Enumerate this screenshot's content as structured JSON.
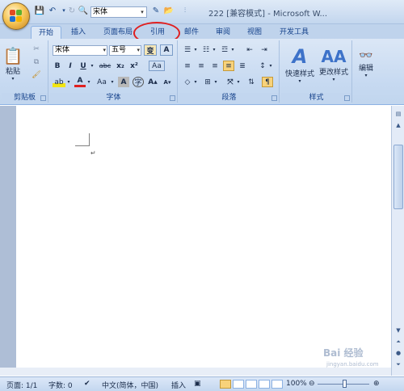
{
  "app": {
    "title": "222 [兼容模式] - Microsoft W..."
  },
  "quick_access": {
    "font_value": "宋体"
  },
  "tabs": [
    {
      "label": "开始",
      "active": true
    },
    {
      "label": "插入"
    },
    {
      "label": "页面布局"
    },
    {
      "label": "引用"
    },
    {
      "label": "邮件"
    },
    {
      "label": "审阅"
    },
    {
      "label": "视图"
    },
    {
      "label": "开发工具"
    }
  ],
  "ribbon": {
    "clipboard": {
      "label": "剪贴板",
      "paste": "粘贴"
    },
    "font": {
      "label": "字体",
      "font_name": "宋体",
      "font_size": "五号"
    },
    "paragraph": {
      "label": "段落"
    },
    "styles": {
      "label": "样式",
      "quick_styles": "快速样式",
      "change_styles": "更改样式"
    },
    "editing": {
      "label": "编辑"
    }
  },
  "status": {
    "page": "页面: 1/1",
    "words": "字数: 0",
    "language": "中文(简体，中国)",
    "insert_mode": "插入",
    "zoom": "100%"
  },
  "watermark": {
    "text": "Bai 经验",
    "url": "jingyan.baidu.com"
  },
  "colors": {
    "accent": "#15428b",
    "annotation_circle": "#e02020",
    "ribbon_bg": "#c6d9f1"
  }
}
